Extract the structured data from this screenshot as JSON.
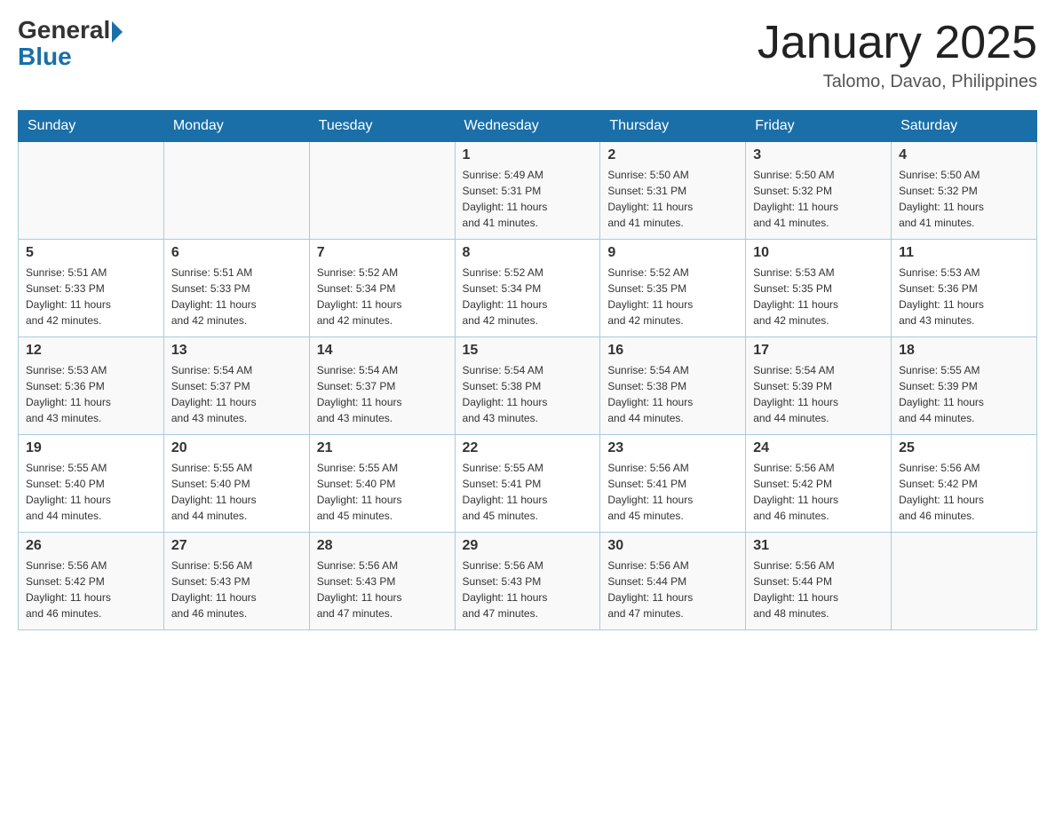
{
  "header": {
    "logo_general": "General",
    "logo_blue": "Blue",
    "month_title": "January 2025",
    "location": "Talomo, Davao, Philippines"
  },
  "weekdays": [
    "Sunday",
    "Monday",
    "Tuesday",
    "Wednesday",
    "Thursday",
    "Friday",
    "Saturday"
  ],
  "weeks": [
    [
      {
        "day": "",
        "info": ""
      },
      {
        "day": "",
        "info": ""
      },
      {
        "day": "",
        "info": ""
      },
      {
        "day": "1",
        "info": "Sunrise: 5:49 AM\nSunset: 5:31 PM\nDaylight: 11 hours\nand 41 minutes."
      },
      {
        "day": "2",
        "info": "Sunrise: 5:50 AM\nSunset: 5:31 PM\nDaylight: 11 hours\nand 41 minutes."
      },
      {
        "day": "3",
        "info": "Sunrise: 5:50 AM\nSunset: 5:32 PM\nDaylight: 11 hours\nand 41 minutes."
      },
      {
        "day": "4",
        "info": "Sunrise: 5:50 AM\nSunset: 5:32 PM\nDaylight: 11 hours\nand 41 minutes."
      }
    ],
    [
      {
        "day": "5",
        "info": "Sunrise: 5:51 AM\nSunset: 5:33 PM\nDaylight: 11 hours\nand 42 minutes."
      },
      {
        "day": "6",
        "info": "Sunrise: 5:51 AM\nSunset: 5:33 PM\nDaylight: 11 hours\nand 42 minutes."
      },
      {
        "day": "7",
        "info": "Sunrise: 5:52 AM\nSunset: 5:34 PM\nDaylight: 11 hours\nand 42 minutes."
      },
      {
        "day": "8",
        "info": "Sunrise: 5:52 AM\nSunset: 5:34 PM\nDaylight: 11 hours\nand 42 minutes."
      },
      {
        "day": "9",
        "info": "Sunrise: 5:52 AM\nSunset: 5:35 PM\nDaylight: 11 hours\nand 42 minutes."
      },
      {
        "day": "10",
        "info": "Sunrise: 5:53 AM\nSunset: 5:35 PM\nDaylight: 11 hours\nand 42 minutes."
      },
      {
        "day": "11",
        "info": "Sunrise: 5:53 AM\nSunset: 5:36 PM\nDaylight: 11 hours\nand 43 minutes."
      }
    ],
    [
      {
        "day": "12",
        "info": "Sunrise: 5:53 AM\nSunset: 5:36 PM\nDaylight: 11 hours\nand 43 minutes."
      },
      {
        "day": "13",
        "info": "Sunrise: 5:54 AM\nSunset: 5:37 PM\nDaylight: 11 hours\nand 43 minutes."
      },
      {
        "day": "14",
        "info": "Sunrise: 5:54 AM\nSunset: 5:37 PM\nDaylight: 11 hours\nand 43 minutes."
      },
      {
        "day": "15",
        "info": "Sunrise: 5:54 AM\nSunset: 5:38 PM\nDaylight: 11 hours\nand 43 minutes."
      },
      {
        "day": "16",
        "info": "Sunrise: 5:54 AM\nSunset: 5:38 PM\nDaylight: 11 hours\nand 44 minutes."
      },
      {
        "day": "17",
        "info": "Sunrise: 5:54 AM\nSunset: 5:39 PM\nDaylight: 11 hours\nand 44 minutes."
      },
      {
        "day": "18",
        "info": "Sunrise: 5:55 AM\nSunset: 5:39 PM\nDaylight: 11 hours\nand 44 minutes."
      }
    ],
    [
      {
        "day": "19",
        "info": "Sunrise: 5:55 AM\nSunset: 5:40 PM\nDaylight: 11 hours\nand 44 minutes."
      },
      {
        "day": "20",
        "info": "Sunrise: 5:55 AM\nSunset: 5:40 PM\nDaylight: 11 hours\nand 44 minutes."
      },
      {
        "day": "21",
        "info": "Sunrise: 5:55 AM\nSunset: 5:40 PM\nDaylight: 11 hours\nand 45 minutes."
      },
      {
        "day": "22",
        "info": "Sunrise: 5:55 AM\nSunset: 5:41 PM\nDaylight: 11 hours\nand 45 minutes."
      },
      {
        "day": "23",
        "info": "Sunrise: 5:56 AM\nSunset: 5:41 PM\nDaylight: 11 hours\nand 45 minutes."
      },
      {
        "day": "24",
        "info": "Sunrise: 5:56 AM\nSunset: 5:42 PM\nDaylight: 11 hours\nand 46 minutes."
      },
      {
        "day": "25",
        "info": "Sunrise: 5:56 AM\nSunset: 5:42 PM\nDaylight: 11 hours\nand 46 minutes."
      }
    ],
    [
      {
        "day": "26",
        "info": "Sunrise: 5:56 AM\nSunset: 5:42 PM\nDaylight: 11 hours\nand 46 minutes."
      },
      {
        "day": "27",
        "info": "Sunrise: 5:56 AM\nSunset: 5:43 PM\nDaylight: 11 hours\nand 46 minutes."
      },
      {
        "day": "28",
        "info": "Sunrise: 5:56 AM\nSunset: 5:43 PM\nDaylight: 11 hours\nand 47 minutes."
      },
      {
        "day": "29",
        "info": "Sunrise: 5:56 AM\nSunset: 5:43 PM\nDaylight: 11 hours\nand 47 minutes."
      },
      {
        "day": "30",
        "info": "Sunrise: 5:56 AM\nSunset: 5:44 PM\nDaylight: 11 hours\nand 47 minutes."
      },
      {
        "day": "31",
        "info": "Sunrise: 5:56 AM\nSunset: 5:44 PM\nDaylight: 11 hours\nand 48 minutes."
      },
      {
        "day": "",
        "info": ""
      }
    ]
  ]
}
